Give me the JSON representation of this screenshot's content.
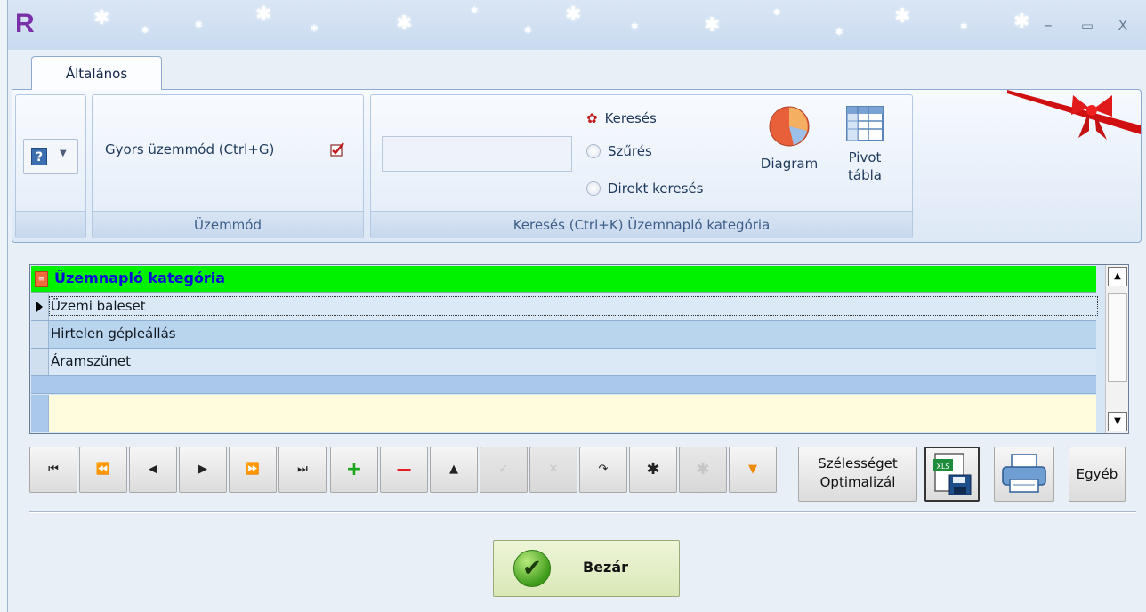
{
  "window": {
    "app_logo": "R",
    "controls": {
      "minimize": "–",
      "maximize": "▭",
      "close": "X"
    }
  },
  "tabs": [
    {
      "label": "Általános"
    }
  ],
  "ribbon": {
    "group_uzemmod": {
      "quick_mode_label": "Gyors üzemmód (Ctrl+G)",
      "caption": "Üzemmód"
    },
    "group_kereses": {
      "search_value": "",
      "options": [
        "Keresés",
        "Szűrés",
        "Direkt keresés"
      ],
      "diagram_label": "Diagram",
      "pivot_label_line1": "Pivot",
      "pivot_label_line2": "tábla",
      "caption": "Keresés (Ctrl+K) Üzemnapló kategória"
    }
  },
  "grid": {
    "header": "Üzemnapló kategória",
    "rows": [
      "Üzemi baleset",
      "Hirtelen gépleállás",
      "Áramszünet"
    ]
  },
  "navigator": {
    "width_opt_line1": "Szélességet",
    "width_opt_line2": "Optimalizál",
    "xls_label": "XLS",
    "other_label": "Egyéb"
  },
  "footer": {
    "close_label": "Bezár"
  },
  "colors": {
    "header_bg": "#00f200",
    "header_text": "#0a10d8",
    "accent": "#7b2fa8"
  }
}
